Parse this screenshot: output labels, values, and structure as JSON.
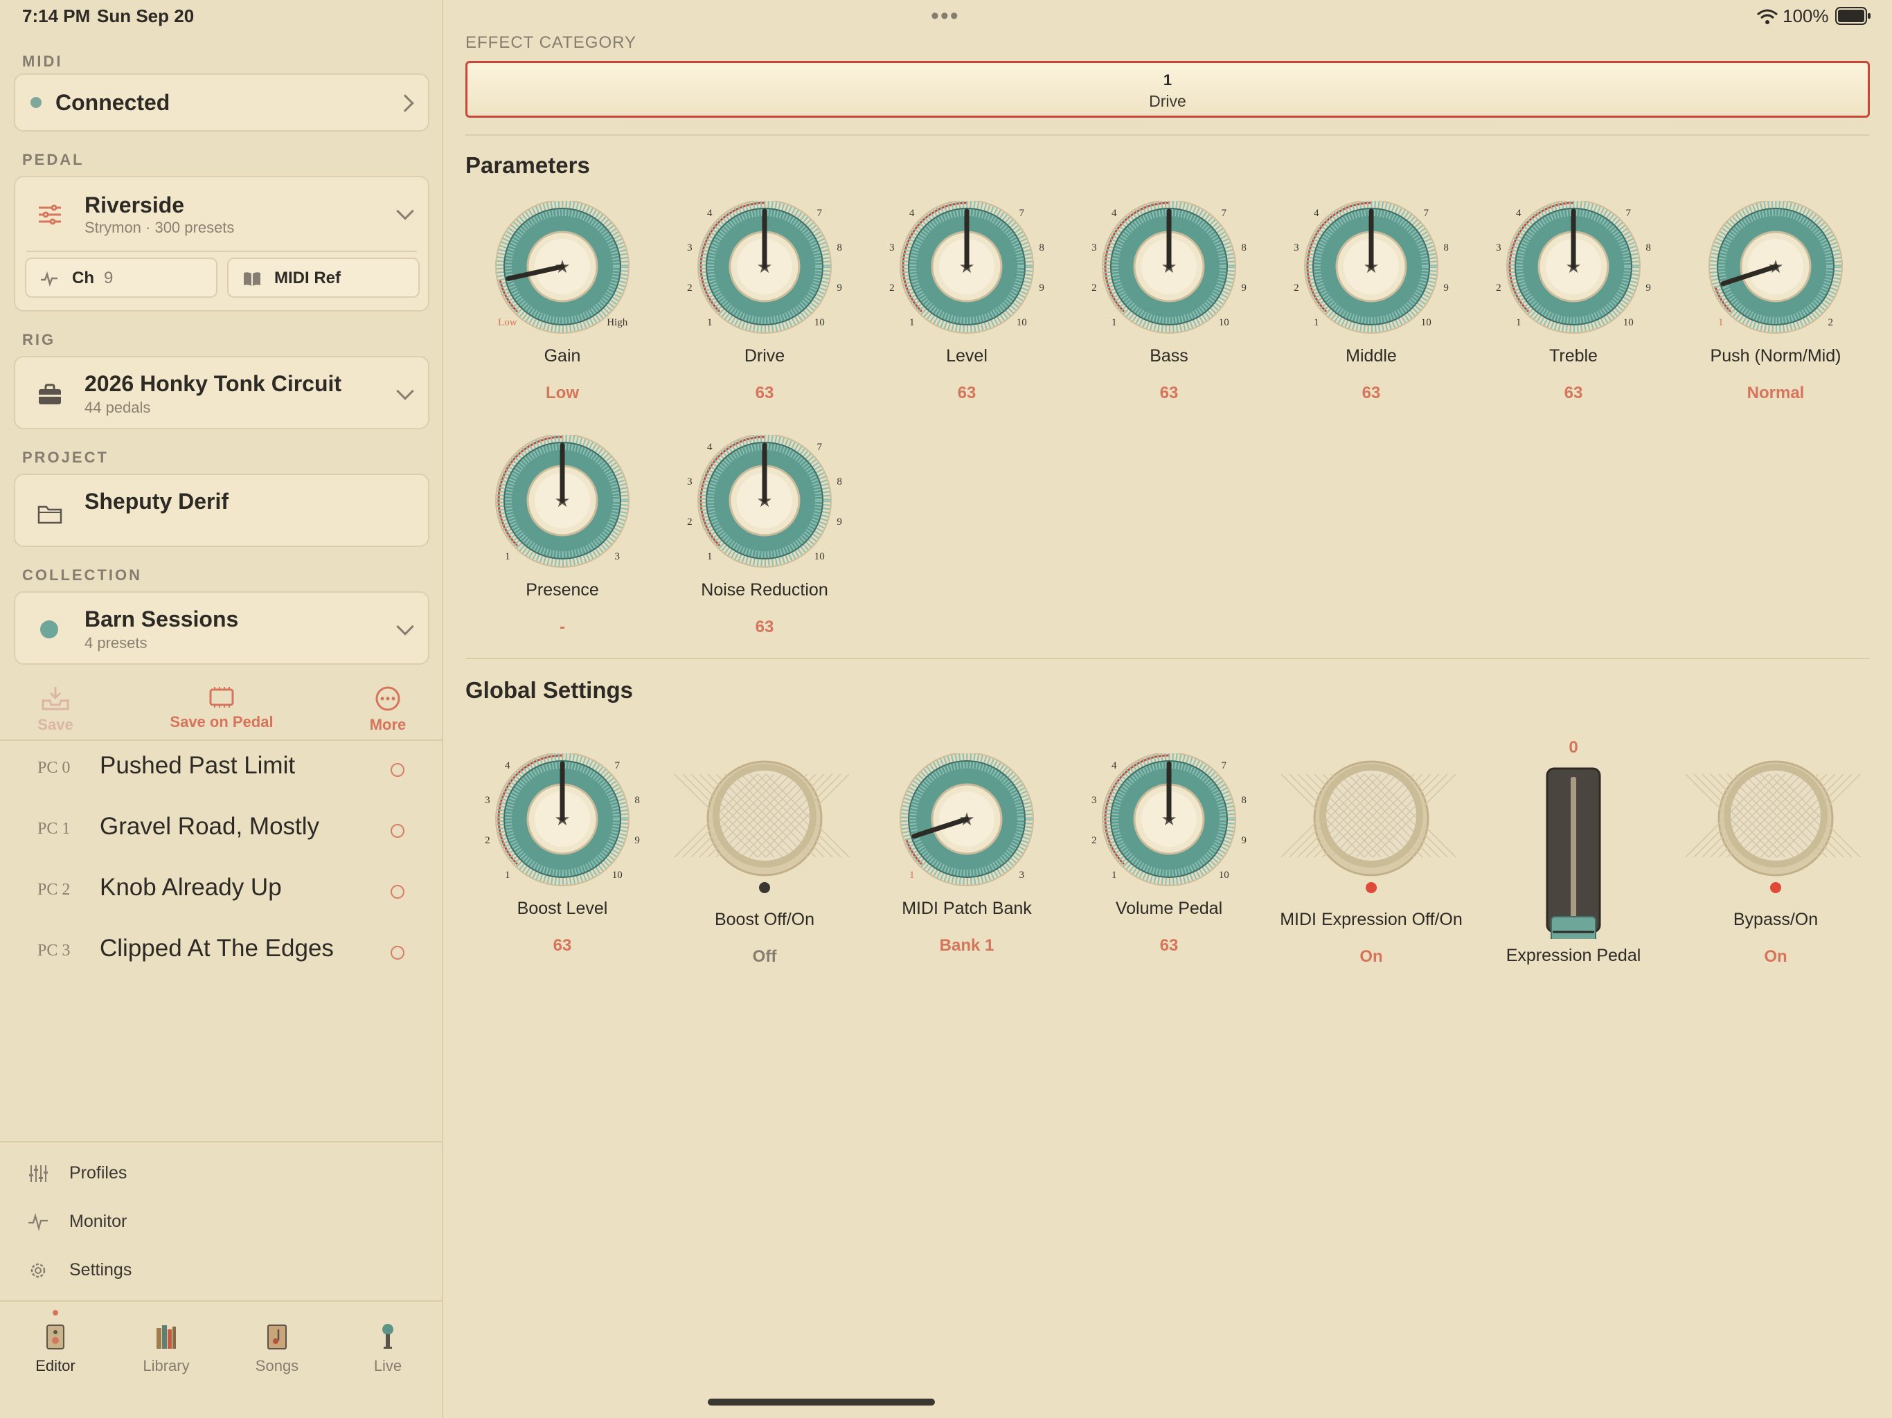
{
  "status_bar": {
    "time": "7:14 PM",
    "date": "Sun Sep 20",
    "battery": "100%",
    "menu": "•••"
  },
  "sidebar": {
    "midi": {
      "label": "MIDI",
      "status": "Connected"
    },
    "pedal": {
      "label": "PEDAL",
      "name": "Riverside",
      "sub": "Strymon · 300 presets",
      "ch_label": "Ch",
      "ch_value": "9",
      "midi_ref": "MIDI Ref"
    },
    "rig": {
      "label": "RIG",
      "name": "2026 Honky Tonk Circuit",
      "sub": "44 pedals"
    },
    "project": {
      "label": "PROJECT",
      "name": "Sheputy Derif"
    },
    "collection": {
      "label": "COLLECTION",
      "name": "Barn Sessions",
      "sub": "4 presets"
    },
    "actions": {
      "save": "Save",
      "save_on_pedal": "Save on Pedal",
      "more": "More"
    },
    "presets": [
      {
        "pc": "PC 0",
        "name": "Pushed Past Limit"
      },
      {
        "pc": "PC 1",
        "name": "Gravel Road, Mostly"
      },
      {
        "pc": "PC 2",
        "name": "Knob Already Up"
      },
      {
        "pc": "PC 3",
        "name": "Clipped At The Edges"
      }
    ],
    "nav": [
      {
        "label": "Profiles",
        "icon": "sliders-icon"
      },
      {
        "label": "Monitor",
        "icon": "pulse-icon"
      },
      {
        "label": "Settings",
        "icon": "gear-icon"
      }
    ],
    "tabs": [
      {
        "label": "Editor",
        "icon": "amp-icon",
        "active": true
      },
      {
        "label": "Library",
        "icon": "books-icon"
      },
      {
        "label": "Songs",
        "icon": "note-icon"
      },
      {
        "label": "Live",
        "icon": "mic-icon"
      }
    ]
  },
  "main": {
    "effect_category": {
      "label": "EFFECT CATEGORY",
      "number": "1",
      "name": "Drive"
    },
    "parameters_heading": "Parameters",
    "global_heading": "Global Settings",
    "parameters": [
      {
        "name": "Gain",
        "value": "Low",
        "scale": [
          "Low",
          "High"
        ],
        "pos": 0.12
      },
      {
        "name": "Drive",
        "value": "63",
        "scale": [
          "1",
          "2",
          "3",
          "4",
          "5",
          "6",
          "7",
          "8",
          "9",
          "10"
        ],
        "pos": 0.5
      },
      {
        "name": "Level",
        "value": "63",
        "scale": [
          "1",
          "2",
          "3",
          "4",
          "5",
          "6",
          "7",
          "8",
          "9",
          "10"
        ],
        "pos": 0.5
      },
      {
        "name": "Bass",
        "value": "63",
        "scale": [
          "1",
          "2",
          "3",
          "4",
          "5",
          "6",
          "7",
          "8",
          "9",
          "10"
        ],
        "pos": 0.5
      },
      {
        "name": "Middle",
        "value": "63",
        "scale": [
          "1",
          "2",
          "3",
          "4",
          "5",
          "6",
          "7",
          "8",
          "9",
          "10"
        ],
        "pos": 0.5
      },
      {
        "name": "Treble",
        "value": "63",
        "scale": [
          "1",
          "2",
          "3",
          "4",
          "5",
          "6",
          "7",
          "8",
          "9",
          "10"
        ],
        "pos": 0.5
      },
      {
        "name": "Push (Norm/Mid)",
        "value": "Normal",
        "scale": [
          "1",
          "2"
        ],
        "pos": 0.1
      },
      {
        "name": "Presence",
        "value": "-",
        "scale": [
          "1",
          "2",
          "3"
        ],
        "pos": 0.5
      },
      {
        "name": "Noise Reduction",
        "value": "63",
        "scale": [
          "1",
          "2",
          "3",
          "4",
          "5",
          "6",
          "7",
          "8",
          "9",
          "10"
        ],
        "pos": 0.5
      }
    ],
    "globals": [
      {
        "name": "Boost Level",
        "value": "63",
        "kind": "knob",
        "scale": [
          "1",
          "2",
          "3",
          "4",
          "5",
          "6",
          "7",
          "8",
          "9",
          "10"
        ],
        "pos": 0.5
      },
      {
        "name": "Boost Off/On",
        "value": "Off",
        "kind": "switch",
        "on": false
      },
      {
        "name": "MIDI Patch Bank",
        "value": "Bank 1",
        "kind": "knob",
        "scale": [
          "1",
          "2",
          "3"
        ],
        "pos": 0.1
      },
      {
        "name": "Volume Pedal",
        "value": "63",
        "kind": "knob",
        "scale": [
          "1",
          "2",
          "3",
          "4",
          "5",
          "6",
          "7",
          "8",
          "9",
          "10"
        ],
        "pos": 0.5
      },
      {
        "name": "MIDI Expression Off/On",
        "value": "On",
        "kind": "switch",
        "on": true
      },
      {
        "name": "Expression Pedal",
        "value": "0",
        "kind": "fader",
        "pos": 0
      },
      {
        "name": "Bypass/On",
        "value": "On",
        "kind": "switch",
        "on": true
      }
    ]
  },
  "colors": {
    "accent": "#d4755c",
    "teal": "#6fa69a",
    "red_led": "#e04a3a",
    "bg": "#ece0c2"
  }
}
